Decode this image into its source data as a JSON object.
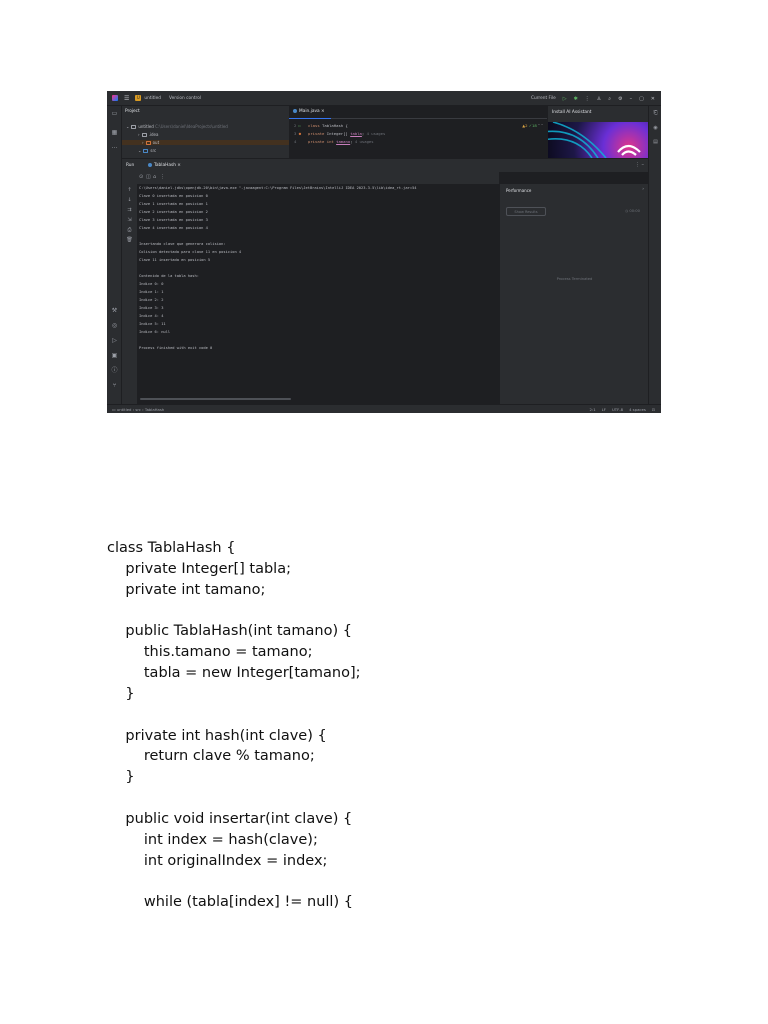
{
  "ide": {
    "titlebar": {
      "menu_icon": "hamburger-menu-icon",
      "project_badge": "U",
      "project_name": "untitled",
      "vcs": "Version control",
      "run_config": "Current File",
      "icons": [
        "run-icon",
        "debug-icon",
        "more-icon",
        "account-icon",
        "search-icon",
        "settings-icon",
        "minimize-icon",
        "maximize-icon",
        "close-icon"
      ]
    },
    "project_panel": {
      "header": "Project",
      "tree": [
        {
          "label": "untitled",
          "path": "C:\\Users\\daniel\\IdeaProjects\\untitled"
        },
        {
          "label": ".idea"
        },
        {
          "label": "out"
        },
        {
          "label": "src"
        }
      ]
    },
    "editor": {
      "tab": "Main.java",
      "status": {
        "warnings": "2",
        "ok": "18"
      },
      "lines": [
        {
          "num": "2",
          "keyword": "class",
          "rest": " TablaHash {",
          "hint": ""
        },
        {
          "num": "3",
          "keyword": "private",
          "rest": " Integer[] ",
          "field": "tabla",
          "semi": ";",
          "hint": "4 usages"
        },
        {
          "num": "4",
          "keyword": "private int",
          "rest": " ",
          "field": "tamano",
          "semi": ";",
          "hint": "4 usages"
        }
      ]
    },
    "ai_panel": {
      "title": "Install AI Assistant"
    },
    "run": {
      "label": "Run",
      "tab": "TablaHash"
    },
    "console": {
      "lines": [
        "C:\\Users\\daniel.jdks\\openjdk-20\\bin\\java.exe \"-javaagent:C:\\Program Files\\JetBrains\\IntelliJ IDEA 2023.3.5\\lib\\idea_rt.jar=54",
        "Clave 0 insertada en posicion 0",
        "Clave 1 insertada en posicion 1",
        "Clave 2 insertada en posicion 2",
        "Clave 3 insertada en posicion 3",
        "Clave 4 insertada en posicion 4",
        "",
        "Insertando clave que generara colision:",
        "Colision detectada para clave 11 en posicion 4",
        "Clave 11 insertada en posicion 5",
        "",
        "Contenido de la tabla hash:",
        "Indice 0: 0",
        "Indice 1: 1",
        "Indice 2: 2",
        "Indice 3: 3",
        "Indice 4: 4",
        "Indice 5: 11",
        "Indice 6: null",
        "",
        "Process finished with exit code 0"
      ]
    },
    "performance": {
      "title": "Performance",
      "button": "Show Results",
      "time": "00:00",
      "status": "Process Terminated"
    },
    "statusbar": {
      "breadcrumb": [
        "untitled",
        "src",
        "TablaHash"
      ],
      "position": "2:1",
      "line_sep": "LF",
      "encoding": "UTF-8",
      "indent": "4 spaces"
    }
  },
  "code_text": [
    "class TablaHash {",
    "    private Integer[] tabla;",
    "    private int tamano;",
    "",
    "    public TablaHash(int tamano) {",
    "        this.tamano = tamano;",
    "        tabla = new Integer[tamano];",
    "    }",
    "",
    "    private int hash(int clave) {",
    "        return clave % tamano;",
    "    }",
    "",
    "    public void insertar(int clave) {",
    "        int index = hash(clave);",
    "        int originalIndex = index;",
    "",
    "        while (tabla[index] != null) {"
  ]
}
